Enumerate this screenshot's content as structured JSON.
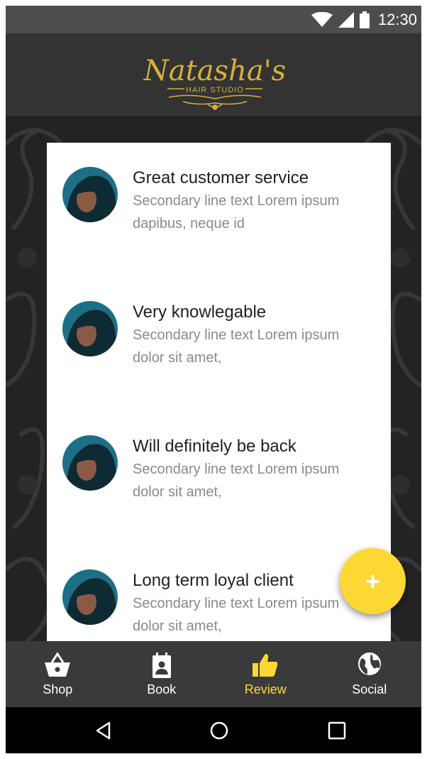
{
  "status_bar": {
    "time": "12:30",
    "icons": [
      "wifi-icon",
      "signal-icon",
      "battery-icon"
    ]
  },
  "app_bar": {
    "logo_script": "Natasha's",
    "logo_subtitle": "HAIR STUDIO"
  },
  "reviews": [
    {
      "title": "Great customer service",
      "secondary": "Secondary line text Lorem ipsum dapibus, neque id"
    },
    {
      "title": "Very knowlegable",
      "secondary": "Secondary line text Lorem ipsum dolor sit amet,"
    },
    {
      "title": "Will definitely be back",
      "secondary": "Secondary line text Lorem ipsum dolor sit amet,"
    },
    {
      "title": "Long term loyal client",
      "secondary": "Secondary line text Lorem ipsum dolor sit amet,"
    }
  ],
  "fab": {
    "label": "+"
  },
  "bottom_nav": [
    {
      "label": "Shop",
      "icon": "shopping-basket-icon",
      "active": false
    },
    {
      "label": "Book",
      "icon": "calendar-person-icon",
      "active": false
    },
    {
      "label": "Review",
      "icon": "thumbs-up-icon",
      "active": true
    },
    {
      "label": "Social",
      "icon": "globe-icon",
      "active": false
    }
  ],
  "system_nav": [
    "back-icon",
    "home-icon",
    "recents-icon"
  ],
  "colors": {
    "accent": "#fdd835",
    "logo_gold": "#d4b13a",
    "app_bar": "#333333",
    "status_bar": "#4d4d4d",
    "bottom_nav": "#3a3a3a"
  }
}
